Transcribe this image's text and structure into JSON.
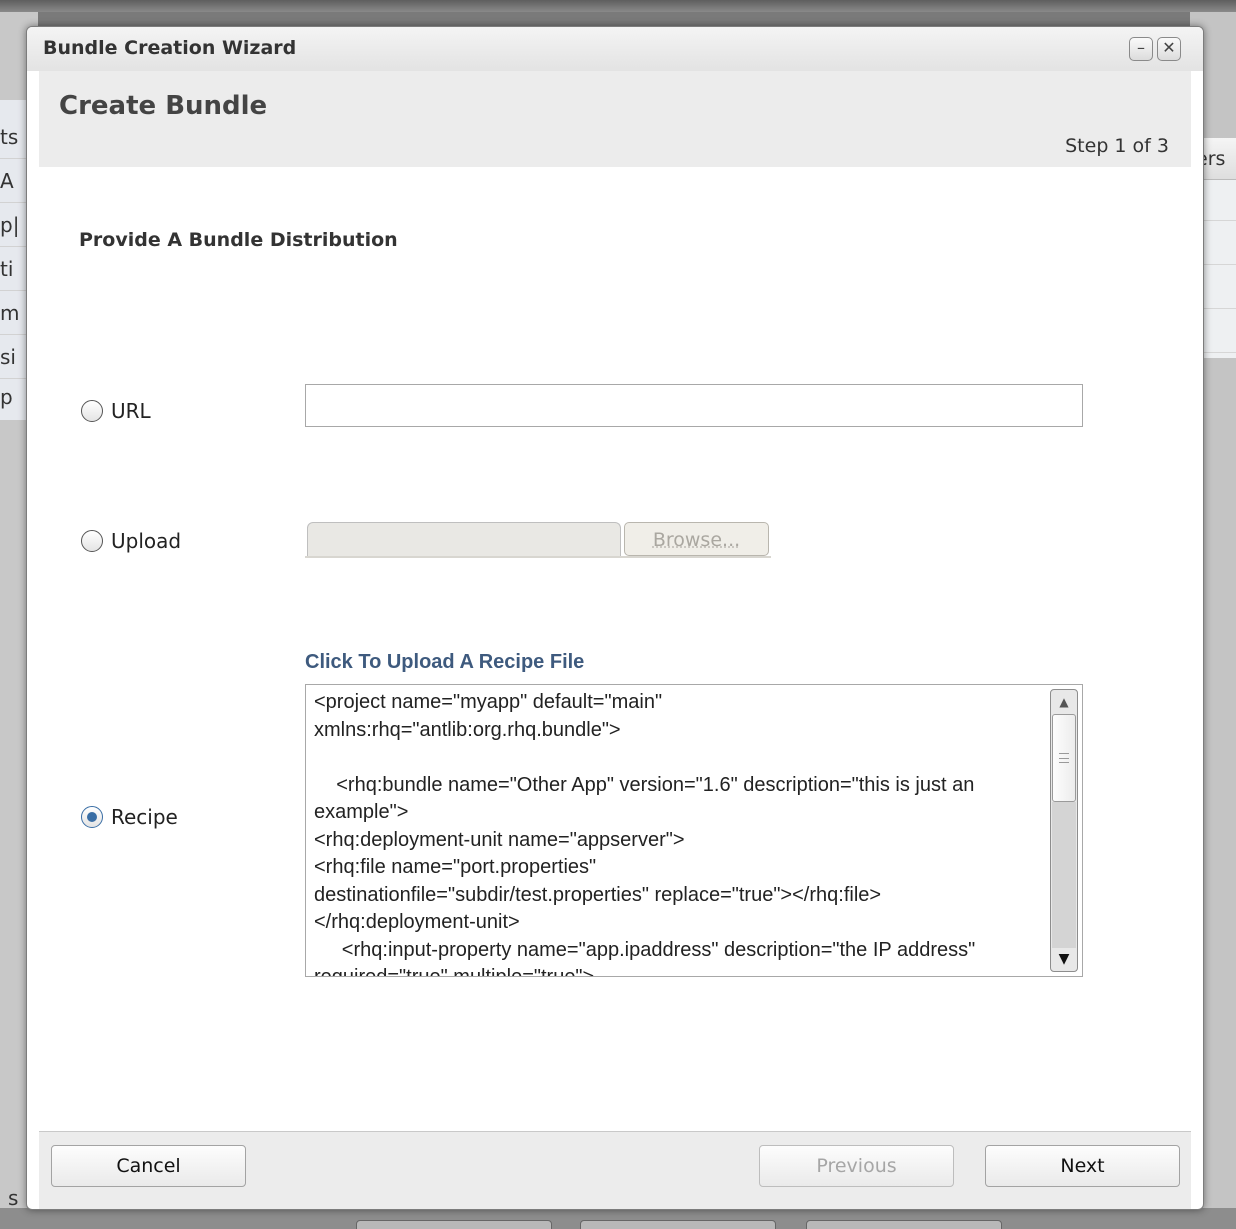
{
  "background": {
    "left_fragments": [
      "ts",
      "A",
      "p|",
      "ti",
      "m",
      "si",
      "p"
    ],
    "right_header": "ers",
    "bottom_left": "s"
  },
  "window": {
    "title": "Bundle Creation Wizard",
    "minimize_glyph": "–",
    "close_glyph": "✕"
  },
  "header": {
    "title": "Create Bundle",
    "step": "Step 1 of 3"
  },
  "section_title": "Provide A Bundle Distribution",
  "options": {
    "url": {
      "label": "URL",
      "value": "",
      "selected": false
    },
    "upload": {
      "label": "Upload",
      "browse_label": "Browse...",
      "selected": false
    },
    "recipe": {
      "label": "Recipe",
      "selected": true
    }
  },
  "recipe_link": "Click To Upload A Recipe File",
  "recipe_content": "<project name=\"myapp\" default=\"main\"\nxmlns:rhq=\"antlib:org.rhq.bundle\">\n\n    <rhq:bundle name=\"Other App\" version=\"1.6\" description=\"this is just an example\">\n<rhq:deployment-unit name=\"appserver\">\n<rhq:file name=\"port.properties\"\ndestinationfile=\"subdir/test.properties\" replace=\"true\"></rhq:file>\n</rhq:deployment-unit>\n     <rhq:input-property name=\"app.ipaddress\" description=\"the IP address\" required=\"true\" multiple=\"true\">",
  "footer": {
    "cancel": "Cancel",
    "previous": "Previous",
    "next": "Next"
  },
  "colors": {
    "accent": "#3a6ea5",
    "link": "#3e5a7e",
    "header_band": "#ececec"
  }
}
